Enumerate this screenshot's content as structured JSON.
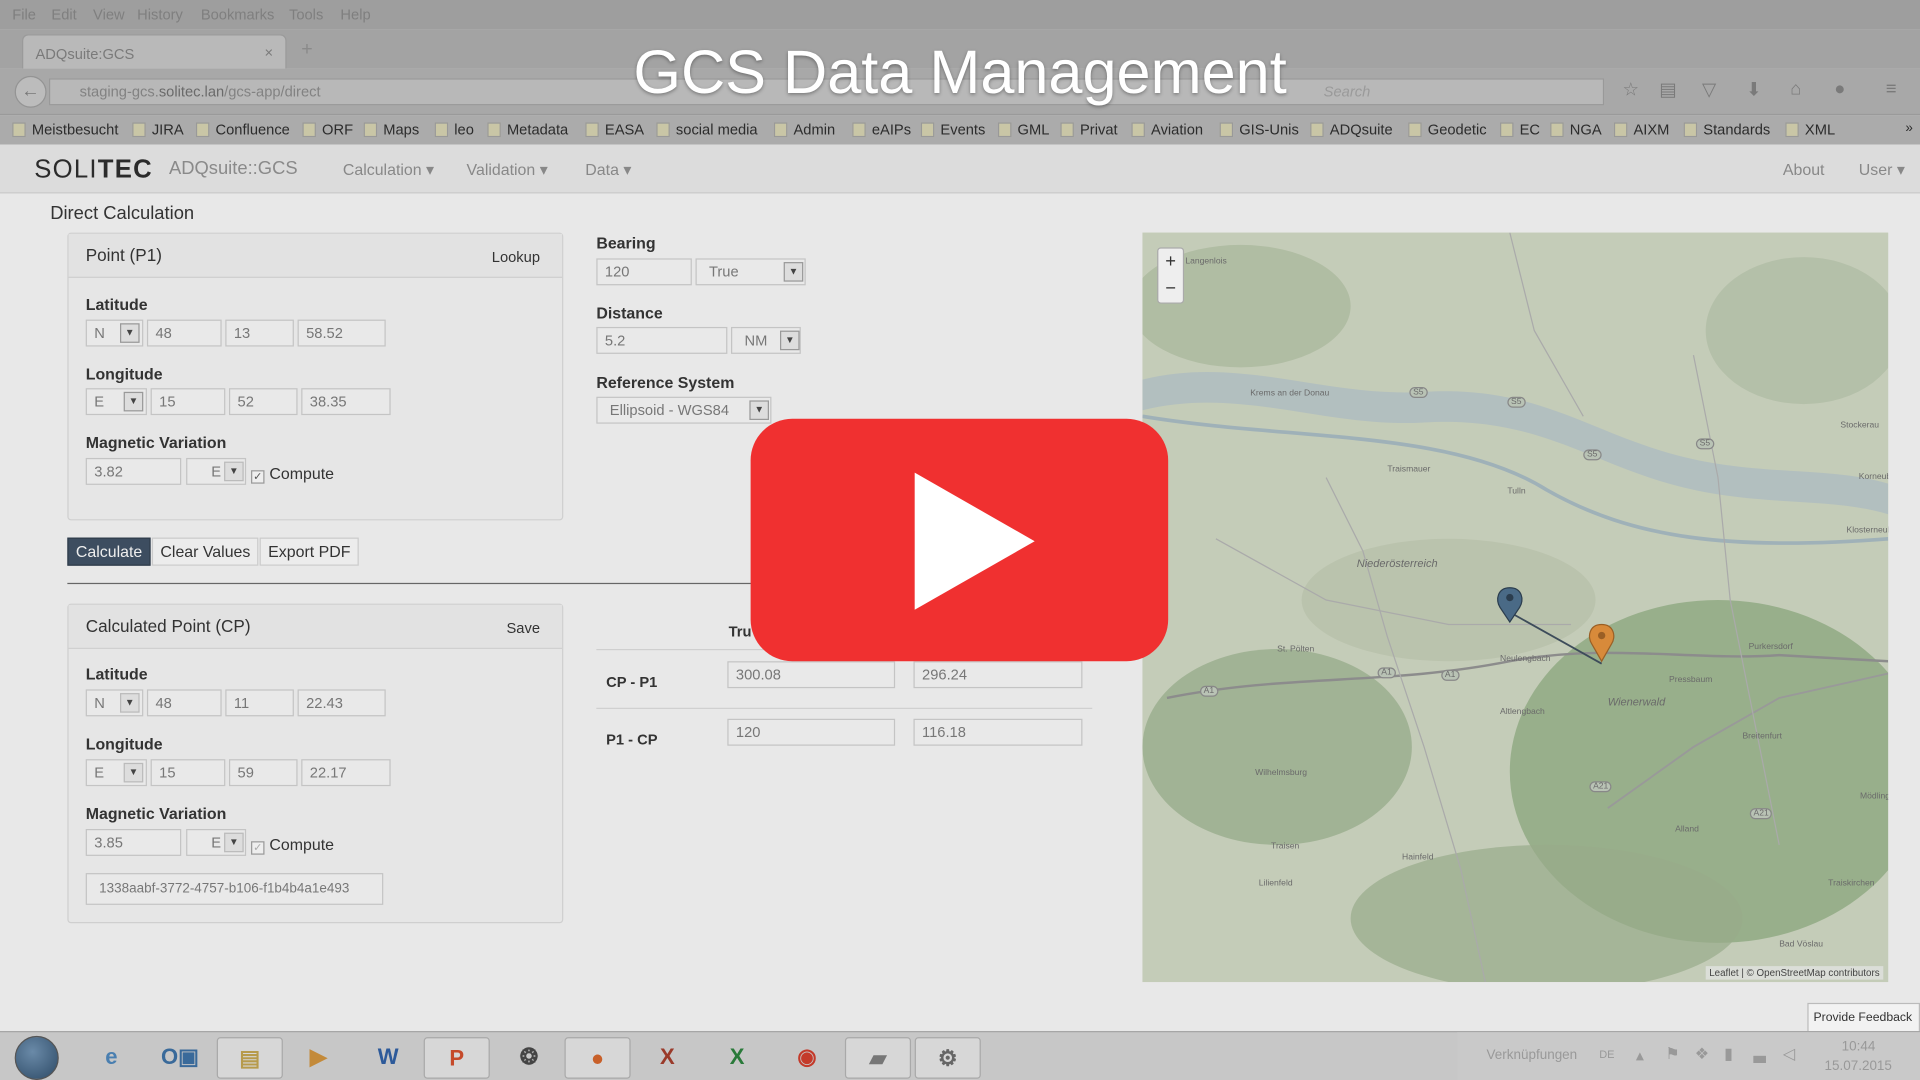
{
  "browser": {
    "menu": [
      "File",
      "Edit",
      "View",
      "History",
      "Bookmarks",
      "Tools",
      "Help"
    ],
    "tab_title": "ADQsuite:GCS",
    "tab_close": "×",
    "new_tab": "+",
    "url_prefix": "staging-gcs.",
    "url_host": "solitec.lan",
    "url_path": "/gcs-app/direct",
    "search_hint": "Search",
    "bookmarks": [
      "Meistbesucht",
      "JIRA",
      "Confluence",
      "ORF",
      "Maps",
      "leo",
      "Metadata",
      "EASA",
      "social media",
      "Admin",
      "eAIPs",
      "Events",
      "GML",
      "Privat",
      "Aviation",
      "GIS-Unis",
      "ADQsuite",
      "Geodetic",
      "EC",
      "NGA",
      "AIXM",
      "Standards",
      "XML"
    ],
    "more_glyph": "»"
  },
  "overlay_title": "GCS Data Management",
  "app": {
    "brand_prefix": "SOLI",
    "brand_suffix": "TEC",
    "product": "ADQsuite::GCS",
    "menus": [
      "Calculation ▾",
      "Validation ▾",
      "Data ▾"
    ],
    "right_menus": [
      "About",
      "User ▾"
    ]
  },
  "page_title": "Direct Calculation",
  "point_p1": {
    "header": "Point (P1)",
    "action": "Lookup",
    "lat_label": "Latitude",
    "lat": {
      "hem": "N",
      "deg": "48",
      "min": "13",
      "sec": "58.52"
    },
    "lon_label": "Longitude",
    "lon": {
      "hem": "E",
      "deg": "15",
      "min": "52",
      "sec": "38.35"
    },
    "magvar_label": "Magnetic Variation",
    "magvar": {
      "value": "3.82",
      "dir": "E",
      "compute": "Compute"
    }
  },
  "bearing": {
    "label": "Bearing",
    "value": "120",
    "type": "True"
  },
  "distance": {
    "label": "Distance",
    "value": "5.2",
    "unit": "NM"
  },
  "refsys": {
    "label": "Reference System",
    "value": "Ellipsoid - WGS84"
  },
  "buttons": {
    "calculate": "Calculate",
    "clear": "Clear Values",
    "export": "Export PDF"
  },
  "calc_point": {
    "header": "Calculated Point (CP)",
    "action": "Save",
    "lat_label": "Latitude",
    "lat": {
      "hem": "N",
      "deg": "48",
      "min": "11",
      "sec": "22.43"
    },
    "lon_label": "Longitude",
    "lon": {
      "hem": "E",
      "deg": "15",
      "min": "59",
      "sec": "22.17"
    },
    "magvar_label": "Magnetic Variation",
    "magvar": {
      "value": "3.85",
      "dir": "E",
      "compute": "Compute"
    },
    "uuid": "1338aabf-3772-4757-b106-f1b4b4a1e493"
  },
  "results": {
    "col_true": "Tru",
    "rows": [
      {
        "label": "CP - P1",
        "true": "300.08",
        "mag": "296.24"
      },
      {
        "label": "P1 - CP",
        "true": "120",
        "mag": "116.18"
      }
    ]
  },
  "map": {
    "zoom_in": "+",
    "zoom_out": "−",
    "attribution": "Leaflet | © OpenStreetMap contributors",
    "places": [
      "Langenlois",
      "Krems an der Donau",
      "Traismauer",
      "Tulln",
      "Stockerau",
      "Niederösterreich",
      "St. Pölten",
      "Neulengbach",
      "Altlengbach",
      "Wienerwald",
      "Purkersdorf",
      "Pressbaum",
      "Breitenfurt",
      "Mödling",
      "Wilhelmsburg",
      "Traisen",
      "Hainfeld",
      "Alland",
      "Lilienfeld",
      "Traiskirchen",
      "Bad Vöslau",
      "Korneuburg",
      "Klosterneuburg"
    ],
    "roads": [
      "S5",
      "S5",
      "S5",
      "S5",
      "A1",
      "A1",
      "A1",
      "A21",
      "A21"
    ],
    "marker_colors": {
      "p1": "#4a6a86",
      "cp": "#d88a3a"
    }
  },
  "feedback": "Provide Feedback",
  "taskbar": {
    "tray_text": "Verknüpfungen",
    "lang": "DE",
    "time": "10:44",
    "date": "15.07.2015",
    "apps": [
      "ie-icon",
      "outlook-icon",
      "files-icon",
      "media-icon",
      "word-icon",
      "powerpoint-icon",
      "aperture-icon",
      "firefox-icon",
      "xmind-icon",
      "excel-icon",
      "chrome-icon",
      "notes-icon",
      "settings-icon"
    ]
  }
}
